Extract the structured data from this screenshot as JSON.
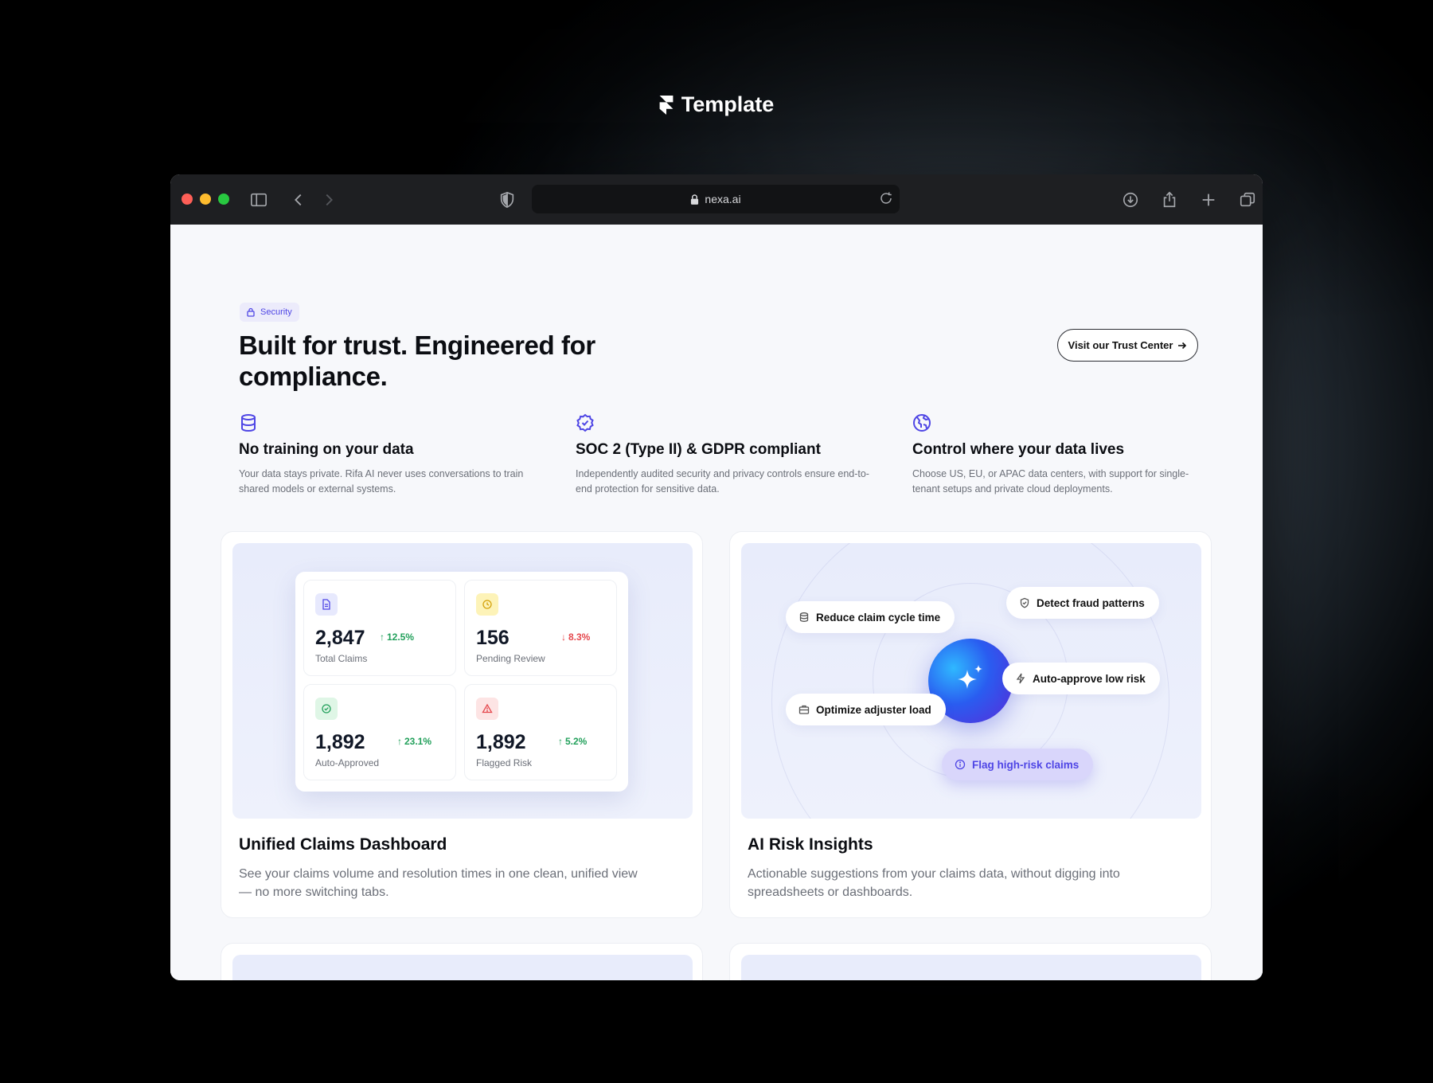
{
  "brand": {
    "name": "Template"
  },
  "browser": {
    "url": "nexa.ai"
  },
  "section": {
    "badge": "Security",
    "headline": "Built for trust. Engineered for compliance.",
    "cta": "Visit our Trust Center"
  },
  "features": [
    {
      "icon": "database-icon",
      "title": "No training on your data",
      "desc": "Your data stays private. Rifa AI never uses conversations to train shared models or external systems."
    },
    {
      "icon": "badge-check-icon",
      "title": "SOC 2 (Type II) & GDPR compliant",
      "desc": "Independently audited security and privacy controls ensure end-to-end protection for sensitive data."
    },
    {
      "icon": "globe-icon",
      "title": "Control where your data lives",
      "desc": "Choose US, EU, or APAC data centers, with support for single-tenant setups and private cloud deployments."
    }
  ],
  "dashboard_card": {
    "title": "Unified Claims Dashboard",
    "desc": "See your claims volume and resolution times in one clean, unified view — no more switching tabs.",
    "stats": [
      {
        "value": "2,847",
        "trend": "12.5%",
        "direction": "up",
        "label": "Total Claims",
        "icon": "document-icon",
        "tint": "#e7e9fd",
        "iconColor": "#4f46e5"
      },
      {
        "value": "156",
        "trend": "8.3%",
        "direction": "down",
        "label": "Pending Review",
        "icon": "clock-icon",
        "tint": "#fdf3b8",
        "iconColor": "#d4a10a"
      },
      {
        "value": "1,892",
        "trend": "23.1%",
        "direction": "up",
        "label": "Auto-Approved",
        "icon": "check-circle-icon",
        "tint": "#dff6e6",
        "iconColor": "#22a05b"
      },
      {
        "value": "1,892",
        "trend": "5.2%",
        "direction": "up",
        "label": "Flagged Risk",
        "icon": "alert-triangle-icon",
        "tint": "#fde4e4",
        "iconColor": "#e5484d"
      }
    ]
  },
  "insights_card": {
    "title": "AI Risk Insights",
    "desc": "Actionable suggestions from your claims data, without digging into spreadsheets or dashboards.",
    "pills": [
      {
        "label": "Reduce claim cycle time",
        "icon": "database-icon"
      },
      {
        "label": "Detect fraud patterns",
        "icon": "shield-check-icon"
      },
      {
        "label": "Auto-approve low risk",
        "icon": "bolt-icon"
      },
      {
        "label": "Optimize adjuster load",
        "icon": "briefcase-icon"
      },
      {
        "label": "Flag high-risk claims",
        "icon": "info-circle-icon"
      }
    ]
  },
  "colors": {
    "accent": "#4f46e5",
    "up": "#22a05b",
    "down": "#e5484d"
  }
}
